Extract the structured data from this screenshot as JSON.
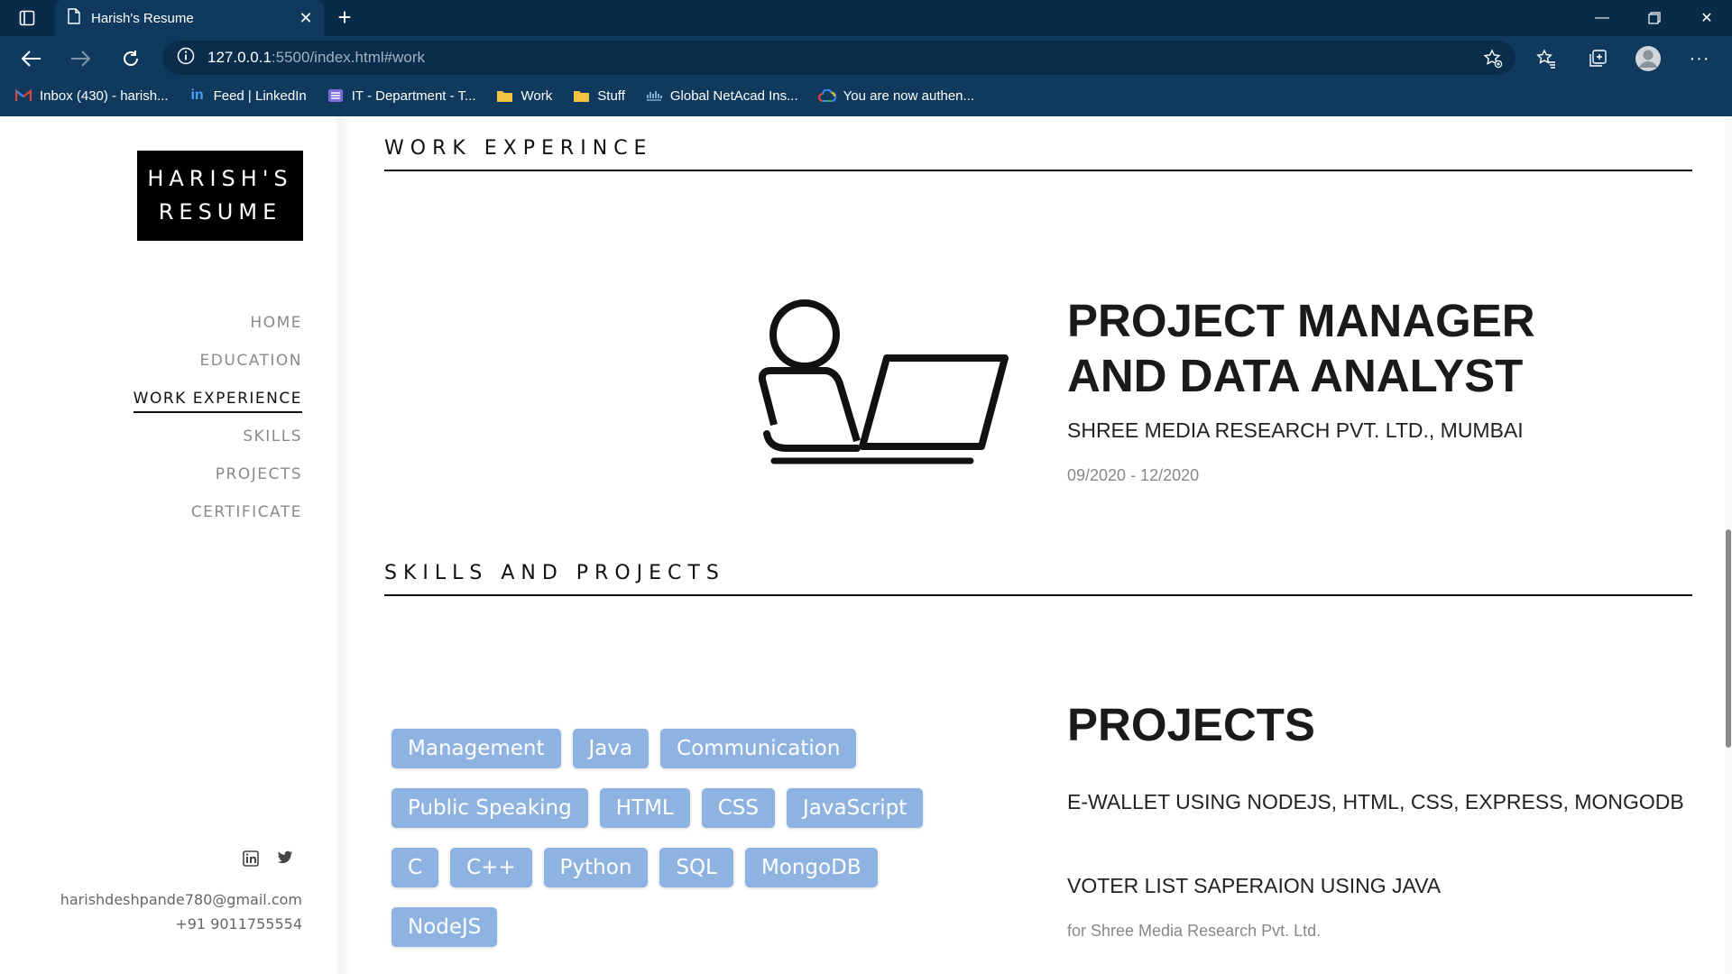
{
  "browser": {
    "tab_title": "Harish's Resume",
    "url_host": "127.0.0.1",
    "url_rest": ":5500/index.html#work",
    "bookmarks": [
      {
        "label": "Inbox (430) - harish...",
        "icon": "gmail-icon"
      },
      {
        "label": "Feed | LinkedIn",
        "icon": "linkedin-icon"
      },
      {
        "label": "IT - Department - T...",
        "icon": "teams-icon"
      },
      {
        "label": "Work",
        "icon": "folder-icon"
      },
      {
        "label": "Stuff",
        "icon": "folder-icon"
      },
      {
        "label": "Global NetAcad Ins...",
        "icon": "netacad-icon"
      },
      {
        "label": "You are now authen...",
        "icon": "google-cloud-icon"
      }
    ]
  },
  "sidebar": {
    "logo_line1": "HARISH'S",
    "logo_line2": "RESUME",
    "nav": [
      "HOME",
      "EDUCATION",
      "WORK EXPERIENCE",
      "SKILLS",
      "PROJECTS",
      "CERTIFICATE"
    ],
    "active_nav": "WORK EXPERIENCE",
    "email": "harishdeshpande780@gmail.com",
    "phone": "+91 9011755554"
  },
  "work": {
    "heading": "WORK EXPERINCE",
    "title": "PROJECT MANAGER AND DATA ANALYST",
    "company": "SHREE MEDIA RESEARCH PVT. LTD., MUMBAI",
    "dates": "09/2020 - 12/2020"
  },
  "skills_projects": {
    "heading": "SKILLS AND PROJECTS",
    "skills": [
      "Management",
      "Java",
      "Communication",
      "Public Speaking",
      "HTML",
      "CSS",
      "JavaScript",
      "C",
      "C++",
      "Python",
      "SQL",
      "MongoDB",
      "NodeJS"
    ],
    "projects_title": "PROJECTS",
    "project1": "E-WALLET USING NODEJS, HTML, CSS, EXPRESS, MONGODB",
    "project2": "VOTER LIST SAPERAION USING JAVA",
    "project2_sub": "for Shree Media Research Pvt. Ltd."
  },
  "colors": {
    "chrome_bg": "#0f3a5e",
    "tabstrip_bg": "#072b48",
    "skill_badge": "#8fb3e0"
  }
}
